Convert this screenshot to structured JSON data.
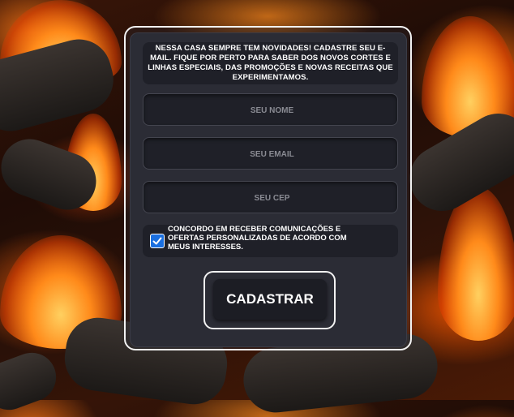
{
  "form": {
    "intro_text": "NESSA CASA SEMPRE TEM NOVIDADES! CADASTRE SEU E-MAIL. FIQUE POR PERTO PARA SABER DOS NOVOS CORTES E LINHAS ESPECIAIS, DAS PROMOÇÕES E NOVAS RECEITAS QUE EXPERIMENTAMOS.",
    "name_placeholder": "SEU NOME",
    "email_placeholder": "SEU EMAIL",
    "cep_placeholder": "SEU CEP",
    "consent_text": "CONCORDO EM RECEBER COMUNICAÇÕES E OFERTAS PERSONALIZADAS DE ACORDO COM MEUS INTERESSES.",
    "consent_checked": true,
    "submit_label": "CADASTRAR"
  },
  "colors": {
    "panel": "#2b2c35",
    "field": "#1f2028",
    "checkbox": "#1a6fe0",
    "border": "#f2f2f2"
  }
}
